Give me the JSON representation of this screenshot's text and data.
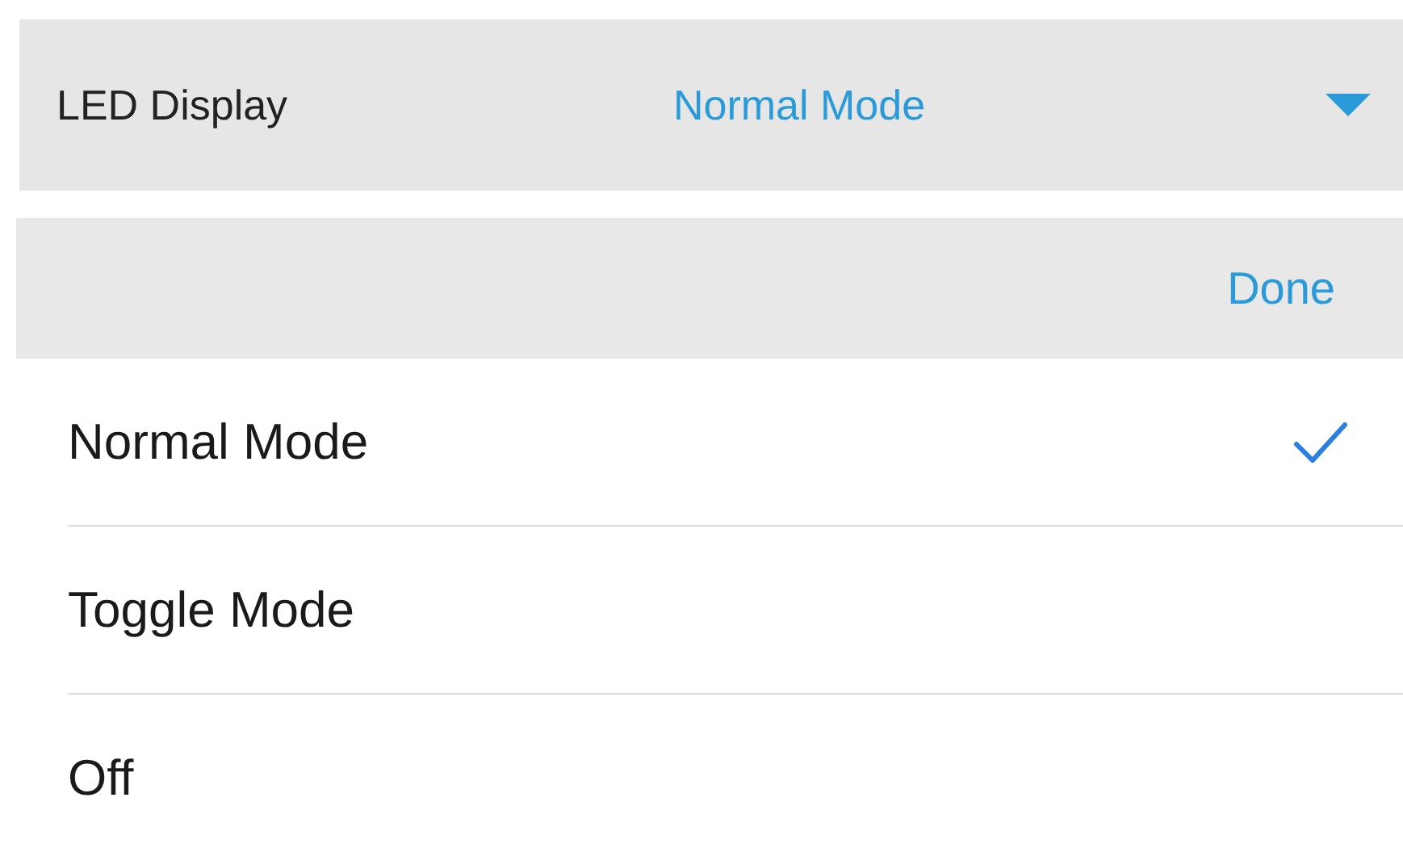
{
  "picker_field": {
    "label": "LED Display",
    "value": "Normal Mode",
    "expanded": true
  },
  "toolbar": {
    "done": "Done"
  },
  "options": [
    {
      "label": "Normal Mode",
      "selected": true
    },
    {
      "label": "Toggle Mode",
      "selected": false
    },
    {
      "label": "Off",
      "selected": false
    }
  ]
}
